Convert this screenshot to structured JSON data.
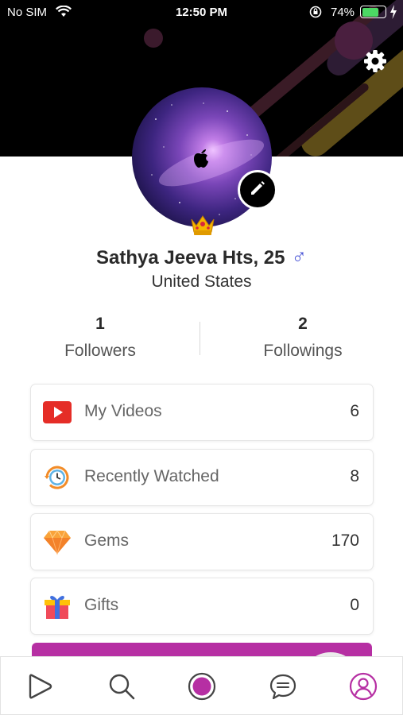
{
  "status_bar": {
    "carrier": "No SIM",
    "time": "12:50 PM",
    "battery_percent": "74%",
    "battery_level": 0.74
  },
  "icons": {
    "settings": "gear-icon",
    "edit": "pencil-icon",
    "crown": "crown-icon",
    "gender": "male-icon"
  },
  "profile": {
    "name_age": "Sathya Jeeva Hts, 25",
    "gender_symbol": "♂",
    "location": "United States"
  },
  "stats": {
    "followers_count": "1",
    "followers_label": "Followers",
    "followings_count": "2",
    "followings_label": "Followings"
  },
  "menu": [
    {
      "icon": "video-play-icon",
      "label": "My Videos",
      "count": "6"
    },
    {
      "icon": "history-clock-icon",
      "label": "Recently Watched",
      "count": "8"
    },
    {
      "icon": "gem-icon",
      "label": "Gems",
      "count": "170"
    },
    {
      "icon": "gift-icon",
      "label": "Gifts",
      "count": "0"
    }
  ],
  "tabbar": {
    "items": [
      "play-tab-icon",
      "search-tab-icon",
      "record-tab-icon",
      "chat-tab-icon",
      "profile-tab-icon"
    ],
    "active": "profile-tab-icon"
  },
  "colors": {
    "accent": "#b62fa3",
    "gender": "#4a55d6",
    "battery": "#4cd964"
  }
}
